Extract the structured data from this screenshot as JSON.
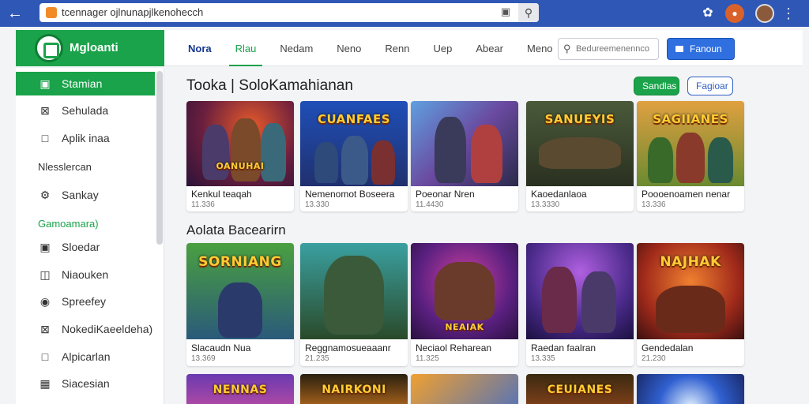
{
  "browser": {
    "url": "tcennager ojlnunapjlkenohecch",
    "icons": {
      "back": "arrow-left-icon",
      "favicon": "favicon-icon",
      "camera": "camera-icon",
      "search": "magnifier-icon",
      "extension": "puzzle-icon",
      "profile": "profile-icon",
      "avatar": "avatar-icon",
      "menu": "kebab-menu-icon"
    }
  },
  "header": {
    "logo_text": "Mgloanti",
    "nav": [
      "Nora",
      "Rlau",
      "Nedam",
      "Neno",
      "Renn",
      "Uep",
      "Abear",
      "Meno"
    ],
    "search_placeholder": "Bedureemenennco",
    "signin_label": "Fanoun"
  },
  "sidebar": {
    "items": [
      {
        "label": "Stamian",
        "icon": "square-icon",
        "active": true
      },
      {
        "label": "Sehulada",
        "icon": "grid-x-icon",
        "active": false
      },
      {
        "label": "Aplik inaa",
        "icon": "folder-icon",
        "active": false
      }
    ],
    "heading_1": "Nlesslercan",
    "item_4": {
      "label": "Sankay",
      "icon": "gear-icon"
    },
    "heading_2": "Gamoamara)",
    "items_2": [
      {
        "label": "Sloedar",
        "icon": "square-icon"
      },
      {
        "label": "Niaouken",
        "icon": "book-icon"
      },
      {
        "label": "Spreefey",
        "icon": "circle-icon"
      },
      {
        "label": "NokediKaeeldeha)",
        "icon": "grid-x-icon"
      },
      {
        "label": "Alpicarlan",
        "icon": "square-outline-icon"
      },
      {
        "label": "Siacesian",
        "icon": "box-icon"
      }
    ]
  },
  "main": {
    "section_1": {
      "title": "Tooka | SoloKamahianan",
      "btn_primary": "Sandlas",
      "btn_secondary": "Fagioar",
      "games": [
        {
          "art_title": "OANUHAI",
          "name": "Kenkul teaqah",
          "count": "11.336"
        },
        {
          "art_title": "CUANFAES",
          "name": "Nemenomot Boseera",
          "count": "13.330"
        },
        {
          "art_title": "",
          "name": "Poeonar Nren",
          "count": "11.4430"
        },
        {
          "art_title": "SANUEYIS",
          "name": "Kaoedanlaoa",
          "count": "13.3330"
        },
        {
          "art_title": "SAGIIANES",
          "name": "Poooenoamen nenar",
          "count": "13.336"
        }
      ]
    },
    "section_2": {
      "title": "Aolata Bacearirn",
      "games": [
        {
          "art_title": "SORNIANG",
          "name": "Slacaudn Nua",
          "count": "13.369"
        },
        {
          "art_title": "",
          "name": "Reggnamosueaaanr",
          "count": "21.235"
        },
        {
          "art_title": "NEAIAK",
          "name": "Neciaol Reharean",
          "count": "11.325"
        },
        {
          "art_title": "",
          "name": "Raedan faalran",
          "count": "13.335"
        },
        {
          "art_title": "NAJHAK",
          "name": "Gendedalan",
          "count": "21.230"
        }
      ]
    },
    "section_3": {
      "games": [
        {
          "art_title": "NENNAS"
        },
        {
          "art_title": "NAIRKONI"
        },
        {
          "art_title": ""
        },
        {
          "art_title": "CEUIANES"
        },
        {
          "art_title": ""
        }
      ]
    }
  },
  "colors": {
    "browser_bar": "#2f57b6",
    "accent_green": "#1aa34a",
    "accent_blue": "#2f6fe0"
  }
}
